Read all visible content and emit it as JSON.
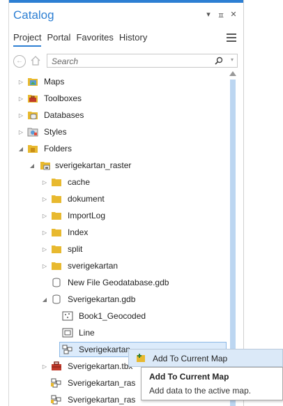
{
  "panel": {
    "title": "Catalog",
    "controls": {
      "dropdown": "▾",
      "pin": "ㅍ",
      "close": "✕"
    },
    "tabs": [
      {
        "label": "Project",
        "active": true
      },
      {
        "label": "Portal",
        "active": false
      },
      {
        "label": "Favorites",
        "active": false
      },
      {
        "label": "History",
        "active": false
      }
    ],
    "search": {
      "placeholder": "Search"
    }
  },
  "tree": {
    "items": [
      {
        "label": "Maps",
        "icon": "maps-icon",
        "expander": "collapsed"
      },
      {
        "label": "Toolboxes",
        "icon": "toolbox-icon",
        "expander": "collapsed"
      },
      {
        "label": "Databases",
        "icon": "database-folder-icon",
        "expander": "collapsed"
      },
      {
        "label": "Styles",
        "icon": "styles-icon",
        "expander": "collapsed"
      },
      {
        "label": "Folders",
        "icon": "folders-icon",
        "expander": "expanded"
      },
      {
        "label": "sverigekartan_raster",
        "icon": "folder-connection-icon",
        "expander": "expanded"
      },
      {
        "label": "cache",
        "icon": "folder-icon",
        "expander": "collapsed"
      },
      {
        "label": "dokument",
        "icon": "folder-icon",
        "expander": "collapsed"
      },
      {
        "label": "ImportLog",
        "icon": "folder-icon",
        "expander": "collapsed"
      },
      {
        "label": "Index",
        "icon": "folder-icon",
        "expander": "collapsed"
      },
      {
        "label": "split",
        "icon": "folder-icon",
        "expander": "collapsed"
      },
      {
        "label": "sverigekartan",
        "icon": "folder-icon",
        "expander": "collapsed"
      },
      {
        "label": "New File Geodatabase.gdb",
        "icon": "geodatabase-icon",
        "expander": "none"
      },
      {
        "label": "Sverigekartan.gdb",
        "icon": "geodatabase-icon",
        "expander": "expanded"
      },
      {
        "label": "Book1_Geocoded",
        "icon": "point-feature-class-icon",
        "expander": "none"
      },
      {
        "label": "Line",
        "icon": "line-feature-class-icon",
        "expander": "none"
      },
      {
        "label": "Sverigekartan",
        "icon": "raster-dataset-icon",
        "expander": "none",
        "selected": true
      },
      {
        "label": "Sverigekartan.tbx",
        "icon": "toolbox-file-icon",
        "expander": "collapsed"
      },
      {
        "label": "Sverigekartan_ras",
        "icon": "raster-layer-icon",
        "expander": "none"
      },
      {
        "label": "Sverigekartan_ras",
        "icon": "raster-layer-icon",
        "expander": "none"
      }
    ]
  },
  "context_menu": {
    "item_label": "Add To Current Map"
  },
  "tooltip": {
    "title": "Add To Current Map",
    "description": "Add data to the active map."
  },
  "colors": {
    "accent": "#2d7fd3",
    "folder": "#e8b92f",
    "selection": "#dcebfb",
    "scrollbar_thumb": "#bcd6f1"
  }
}
